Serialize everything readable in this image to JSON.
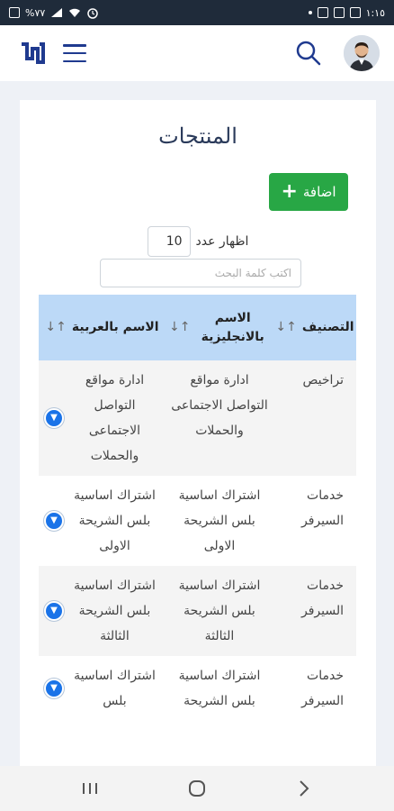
{
  "status_bar": {
    "battery": "%٧٧",
    "time": "١:١٥"
  },
  "header": {
    "logo_icon": "brand-logo-icon",
    "menu_icon": "hamburger-menu-icon",
    "search_icon": "search-icon",
    "avatar_icon": "user-avatar"
  },
  "page": {
    "title": "المنتجات",
    "add_label": "اضافة",
    "add_icon": "plus-icon",
    "length_label": "اظهار عدد",
    "length_value": "10",
    "search_placeholder": "اكتب كلمة البحث"
  },
  "table": {
    "columns": [
      "التصنيف",
      "الاسم بالانجليزية",
      "الاسم بالعربية"
    ],
    "rows": [
      {
        "category": "تراخيص",
        "name_en": "ادارة مواقع التواصل الاجتماعى والحملات",
        "name_ar": "ادارة مواقع التواصل الاجتماعى والحملات"
      },
      {
        "category": "خدمات السيرفر",
        "name_en": "اشتراك اساسية بلس الشريحة الاولى",
        "name_ar": "اشتراك اساسية بلس الشريحة الاولى"
      },
      {
        "category": "خدمات السيرفر",
        "name_en": "اشتراك اساسية بلس الشريحة الثالثة",
        "name_ar": "اشتراك اساسية بلس الشريحة الثالثة"
      },
      {
        "category": "خدمات السيرفر",
        "name_en": "اشتراك اساسية بلس الشريحة",
        "name_ar": "اشتراك اساسية بلس"
      }
    ]
  },
  "colors": {
    "accent": "#1f3a8f",
    "header_bg": "#bcd9f7",
    "add_button": "#28a745",
    "status_bar": "#1f2b3a"
  }
}
